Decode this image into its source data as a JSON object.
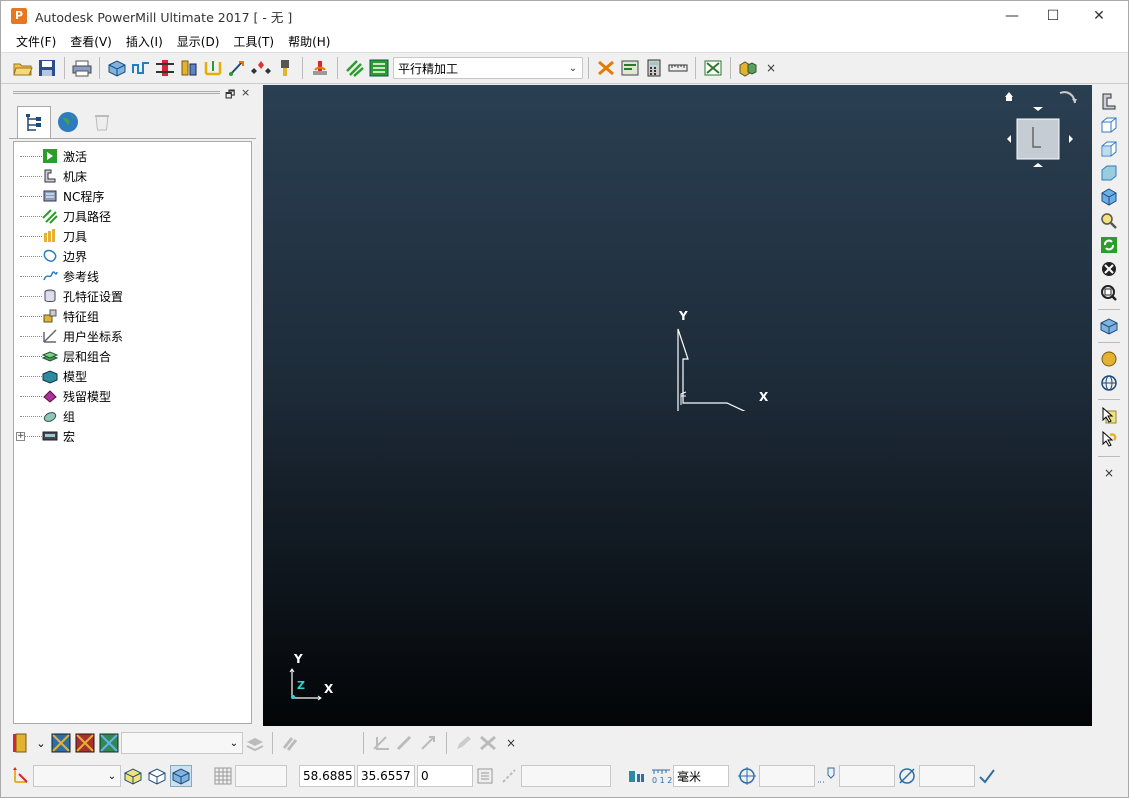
{
  "window": {
    "logo_letter": "P",
    "title": "Autodesk PowerMill Ultimate 2017   [  - 无 ]",
    "minimize": "—",
    "maximize": "☐",
    "close": "✕"
  },
  "menu": {
    "items": [
      "文件(F)",
      "查看(V)",
      "插入(I)",
      "显示(D)",
      "工具(T)",
      "帮助(H)"
    ]
  },
  "toolbar": {
    "strategy_value": "平行精加工",
    "dropdown_arrow": "⌄",
    "close_glyph": "×"
  },
  "explorer": {
    "header_restore": "🗗",
    "header_close": "×",
    "tree": [
      {
        "label": "激活",
        "icon": "activate-icon"
      },
      {
        "label": "机床",
        "icon": "machine-icon"
      },
      {
        "label": "NC程序",
        "icon": "nc-program-icon"
      },
      {
        "label": "刀具路径",
        "icon": "toolpath-icon"
      },
      {
        "label": "刀具",
        "icon": "tool-icon"
      },
      {
        "label": "边界",
        "icon": "boundary-icon"
      },
      {
        "label": "参考线",
        "icon": "pattern-icon"
      },
      {
        "label": "孔特征设置",
        "icon": "hole-feature-icon"
      },
      {
        "label": "特征组",
        "icon": "feature-group-icon"
      },
      {
        "label": "用户坐标系",
        "icon": "workplane-icon"
      },
      {
        "label": "层和组合",
        "icon": "layers-icon"
      },
      {
        "label": "模型",
        "icon": "model-icon"
      },
      {
        "label": "残留模型",
        "icon": "stock-model-icon"
      },
      {
        "label": "组",
        "icon": "group-icon"
      },
      {
        "label": "宏",
        "icon": "macro-icon",
        "expand": "+"
      }
    ]
  },
  "viewport": {
    "axis_center_y": "Y",
    "axis_center_x": "X",
    "axis_center_z": "Z",
    "axis_corner_y": "Y",
    "axis_corner_x": "X",
    "axis_corner_z": "Z"
  },
  "statusbar": {
    "coord_x": "58.6885",
    "coord_y": "35.6557",
    "coord_z": "0",
    "units": "毫米",
    "dropdown_arrow": "⌄",
    "close_glyph": "×"
  },
  "colors": {
    "viewport_top": "#2a3f52",
    "viewport_bottom": "#030507",
    "activate_green": "#2a9d2a"
  }
}
